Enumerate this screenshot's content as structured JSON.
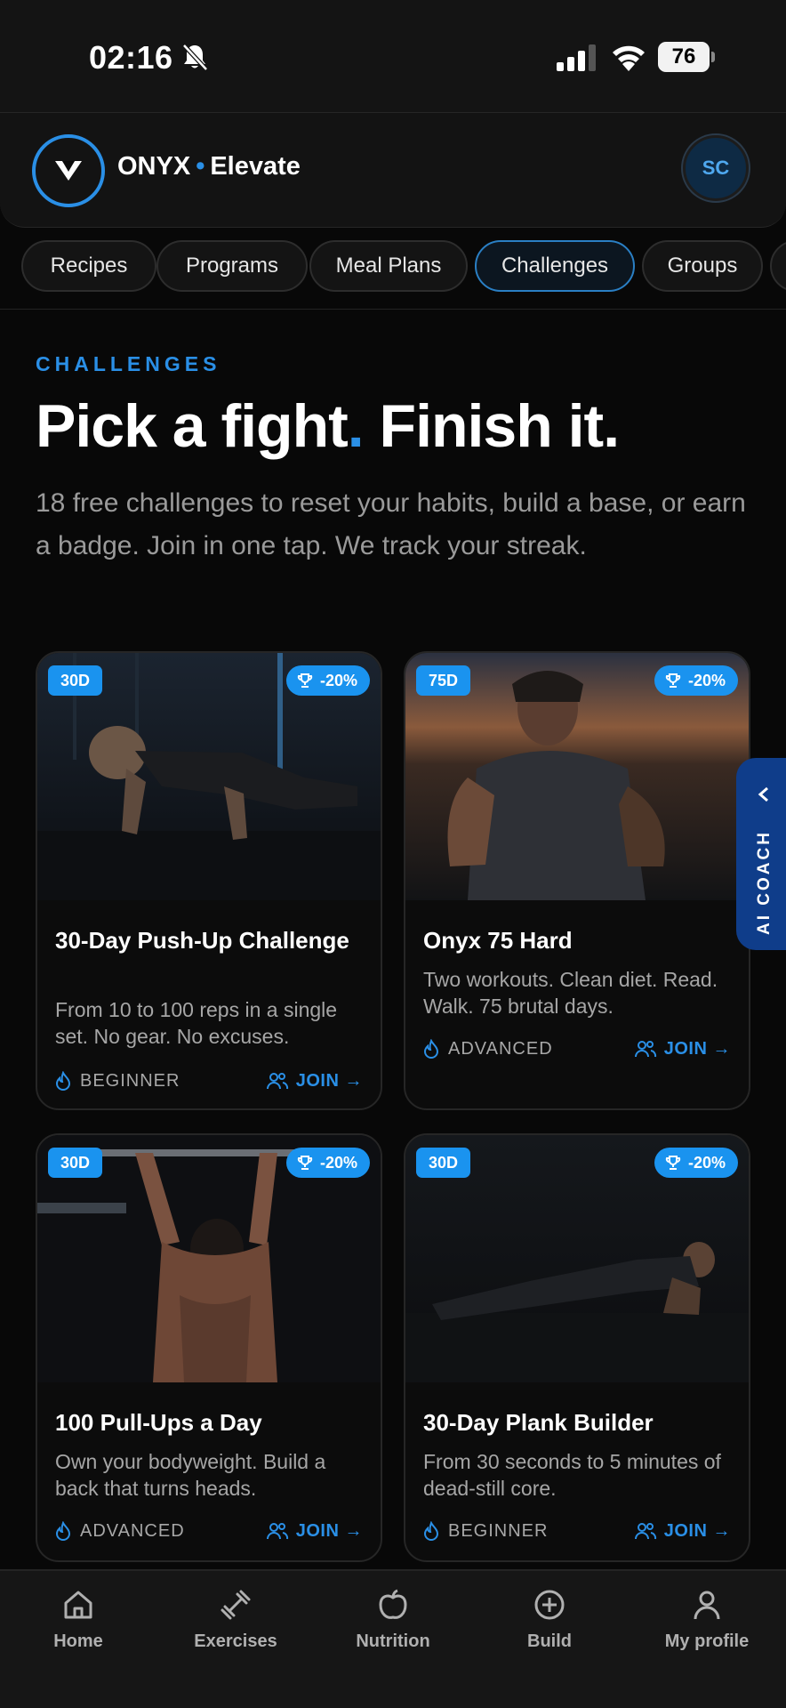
{
  "status_bar": {
    "time": "02:16",
    "battery": "76"
  },
  "header": {
    "brand": "ONYX",
    "separator": "•",
    "product": "Elevate",
    "avatar_initials": "SC"
  },
  "tabs": [
    {
      "label": "Recipes",
      "active": false
    },
    {
      "label": "Programs",
      "active": false
    },
    {
      "label": "Meal Plans",
      "active": false
    },
    {
      "label": "Challenges",
      "active": true
    },
    {
      "label": "Groups",
      "active": false
    }
  ],
  "intro": {
    "eyebrow": "CHALLENGES",
    "headline_part1": "Pick a fight",
    "headline_dot": ".",
    "headline_part2": " Finish it.",
    "description": "18 free challenges to reset your habits, build a base, or earn a badge. Join in one tap. We track your streak."
  },
  "cards": [
    {
      "days": "30D",
      "reward": "-20%",
      "title": "30-Day Push-Up Challenge",
      "description": "From 10 to 100 reps in a single set. No gear. No excuses.",
      "level": "BEGINNER",
      "join": "JOIN →"
    },
    {
      "days": "75D",
      "reward": "-20%",
      "title": "Onyx 75 Hard",
      "description": "Two workouts. Clean diet. Read. Walk. 75 brutal days.",
      "level": "ADVANCED",
      "join": "JOIN →"
    },
    {
      "days": "30D",
      "reward": "-20%",
      "title": "100 Pull-Ups a Day",
      "description": "Own your bodyweight. Build a back that turns heads.",
      "level": "ADVANCED",
      "join": "JOIN →"
    },
    {
      "days": "30D",
      "reward": "-20%",
      "title": "30-Day Plank Builder",
      "description": "From 30 seconds to 5 minutes of dead-still core.",
      "level": "BEGINNER",
      "join": "JOIN →"
    }
  ],
  "coach": {
    "label": "AI COACH"
  },
  "nav": [
    {
      "label": "Home",
      "icon": "home-icon"
    },
    {
      "label": "Exercises",
      "icon": "dumbbell-icon"
    },
    {
      "label": "Nutrition",
      "icon": "apple-icon"
    },
    {
      "label": "Build",
      "icon": "plus-circle-icon"
    },
    {
      "label": "My profile",
      "icon": "user-icon"
    }
  ],
  "colors": {
    "accent": "#2a8fe6",
    "badge": "#1a93ef",
    "background": "#080808",
    "coach": "#0f3d8a"
  }
}
